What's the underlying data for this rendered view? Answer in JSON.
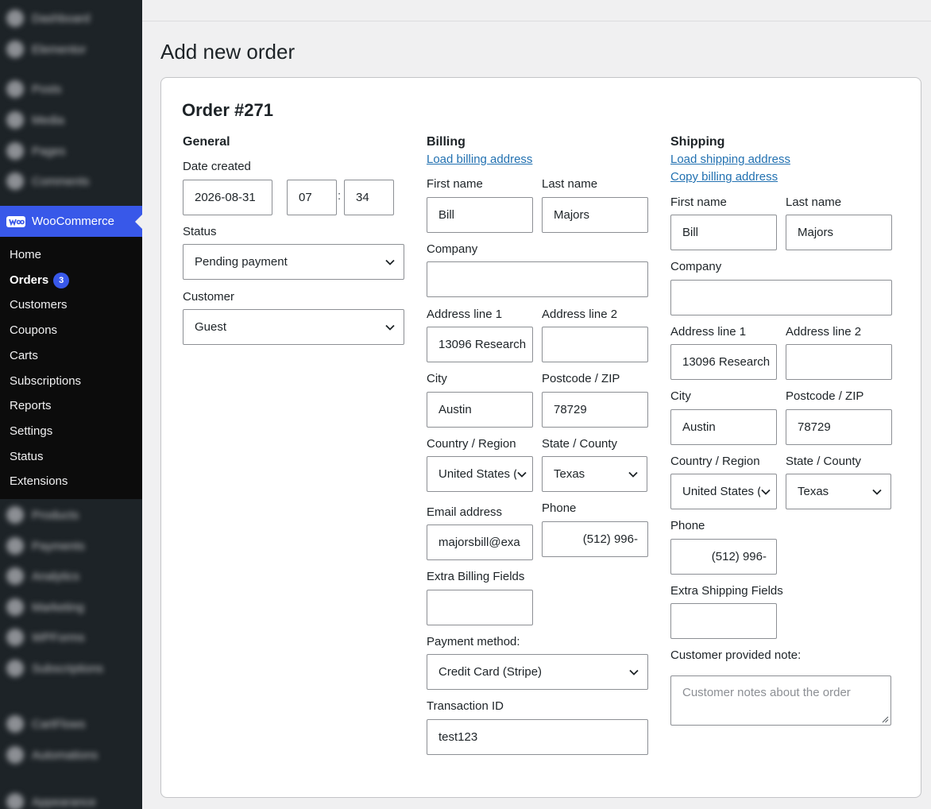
{
  "sidebar": {
    "blurred_top": [
      "Dashboard",
      "Elementor",
      "Posts",
      "Media",
      "Pages",
      "Comments"
    ],
    "woocommerce_label": "WooCommerce",
    "submenu": [
      {
        "label": "Home"
      },
      {
        "label": "Orders",
        "badge": "3"
      },
      {
        "label": "Customers"
      },
      {
        "label": "Coupons"
      },
      {
        "label": "Carts"
      },
      {
        "label": "Subscriptions"
      },
      {
        "label": "Reports"
      },
      {
        "label": "Settings"
      },
      {
        "label": "Status"
      },
      {
        "label": "Extensions"
      }
    ],
    "blurred_bottom": [
      "Products",
      "Payments",
      "Analytics",
      "Marketing",
      "WPForms",
      "Subscriptions",
      "CartFlows",
      "Automations",
      "Appearance"
    ]
  },
  "page_title": "Add new order",
  "order_title": "Order #271",
  "general": {
    "title": "General",
    "date_label": "Date created",
    "date_value": "2026-08-31",
    "hour_value": "07",
    "minute_value": "34",
    "time_sep": ":",
    "status_label": "Status",
    "status_value": "Pending payment",
    "customer_label": "Customer",
    "customer_value": "Guest"
  },
  "billing": {
    "title": "Billing",
    "load_link": "Load billing address",
    "first_name_label": "First name",
    "first_name": "Bill",
    "last_name_label": "Last name",
    "last_name": "Majors",
    "company_label": "Company",
    "company": "",
    "address1_label": "Address line 1",
    "address1": "13096 Research",
    "address2_label": "Address line 2",
    "address2": "",
    "city_label": "City",
    "city": "Austin",
    "postcode_label": "Postcode / ZIP",
    "postcode": "78729",
    "country_label": "Country / Region",
    "country": "United States (US)",
    "state_label": "State / County",
    "state": "Texas",
    "email_label": "Email address",
    "email": "majorsbill@exa",
    "phone_label": "Phone",
    "phone": "(512) 996-",
    "extra_label": "Extra Billing Fields",
    "extra": "",
    "payment_label": "Payment method:",
    "payment": "Credit Card (Stripe)",
    "transaction_label": "Transaction ID",
    "transaction": "test123"
  },
  "shipping": {
    "title": "Shipping",
    "load_link": "Load shipping address",
    "copy_link": "Copy billing address",
    "first_name_label": "First name",
    "first_name": "Bill",
    "last_name_label": "Last name",
    "last_name": "Majors",
    "company_label": "Company",
    "company": "",
    "address1_label": "Address line 1",
    "address1": "13096 Research",
    "address2_label": "Address line 2",
    "address2": "",
    "city_label": "City",
    "city": "Austin",
    "postcode_label": "Postcode / ZIP",
    "postcode": "78729",
    "country_label": "Country / Region",
    "country": "United States (US)",
    "state_label": "State / County",
    "state": "Texas",
    "phone_label": "Phone",
    "phone": "(512) 996-",
    "extra_label": "Extra Shipping Fields",
    "extra": "",
    "note_label": "Customer provided note:",
    "note_placeholder": "Customer notes about the order"
  },
  "colors": {
    "sidebar_bg": "#1d2327",
    "woo_accent": "#3858e9",
    "link": "#2271b1"
  }
}
